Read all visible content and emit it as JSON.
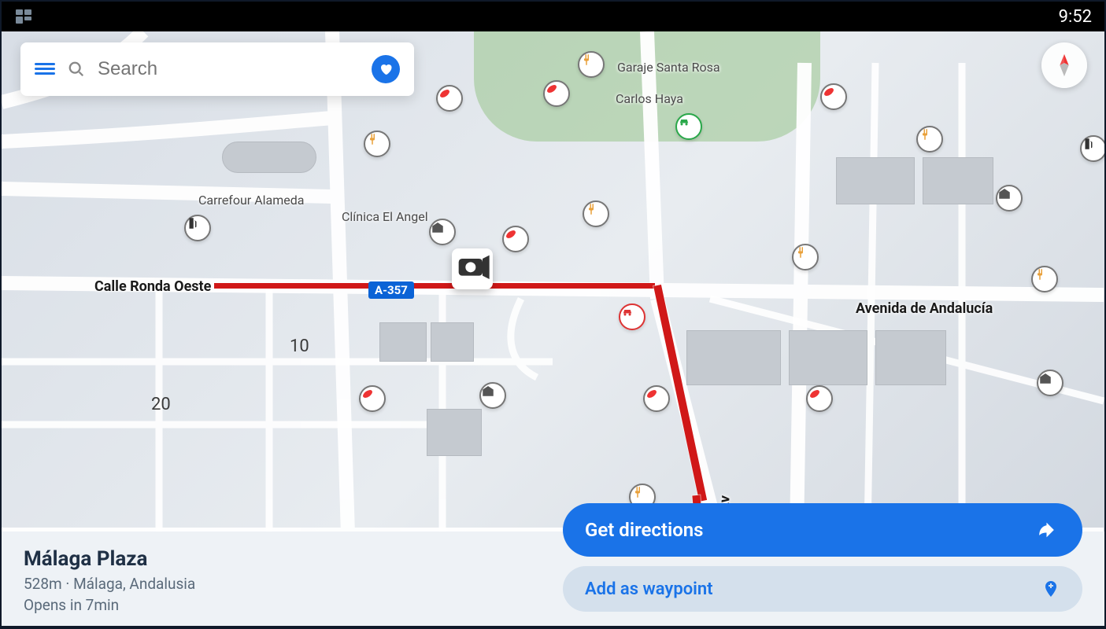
{
  "status": {
    "time": "9:52"
  },
  "search": {
    "placeholder": "Search"
  },
  "map": {
    "labels": {
      "carrefour": "Carrefour Alameda",
      "clinica": "Clínica El Angel",
      "ronda": "Calle Ronda Oeste",
      "andalucia": "Avenida de Andalucía",
      "av": "Av",
      "garaje": "Garaje Santa Rosa",
      "carlos": "Carlos Haya",
      "road_badge": "A-357",
      "num10": "10",
      "num20": "20"
    }
  },
  "place": {
    "name": "Málaga Plaza",
    "distance": "528m",
    "location": "Málaga, Andalusia",
    "hours": "Opens in 7min"
  },
  "actions": {
    "directions": "Get directions",
    "waypoint": "Add as waypoint"
  },
  "colors": {
    "primary": "#1a73e8",
    "route": "#d01818",
    "panel": "#eef2f6"
  }
}
